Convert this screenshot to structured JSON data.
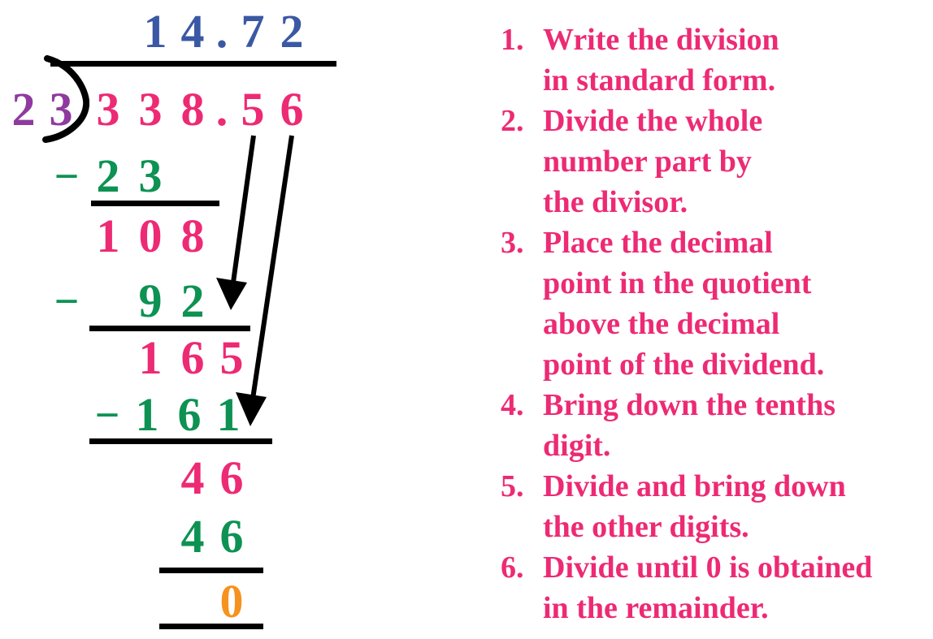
{
  "problem": {
    "type": "long-division-decimal",
    "dividend": "338.56",
    "divisor": "23",
    "quotient": "14.72",
    "remainder": "0"
  },
  "colors": {
    "quotient": "#3a58a4",
    "divisor": "#8f3a9e",
    "dividend": "#ed2a74",
    "subtrahend": "#0d9253",
    "remainder": "#f6921e",
    "rule": "#000000",
    "steps_text": "#ed2a74",
    "background": "#ffffff"
  },
  "work": {
    "quotient_digits": [
      "1",
      "4",
      ".",
      "7",
      "2"
    ],
    "divisor_digits": [
      "2",
      "3"
    ],
    "dividend_digits": [
      "3",
      "3",
      "8",
      ".",
      "5",
      "6"
    ],
    "rows": [
      {
        "name": "subtract-23",
        "sign": "−",
        "digits": [
          "2",
          "3"
        ]
      },
      {
        "name": "partial-108",
        "sign": "",
        "digits": [
          "1",
          "0",
          "8"
        ]
      },
      {
        "name": "subtract-92",
        "sign": "−",
        "digits": [
          "9",
          "2"
        ]
      },
      {
        "name": "partial-165",
        "sign": "",
        "digits": [
          "1",
          "6",
          "5"
        ]
      },
      {
        "name": "subtract-161",
        "sign": "−",
        "digits": [
          "1",
          "6",
          "1"
        ]
      },
      {
        "name": "partial-46",
        "sign": "",
        "digits": [
          "4",
          "6"
        ]
      },
      {
        "name": "subtract-46",
        "sign": "",
        "digits": [
          "4",
          "6"
        ]
      },
      {
        "name": "remainder-0",
        "sign": "",
        "digits": [
          "0"
        ]
      }
    ]
  },
  "steps": {
    "title": "",
    "items": [
      {
        "number": "1.",
        "text": "Write the division\nin standard form."
      },
      {
        "number": "2.",
        "text": "Divide the whole\nnumber part by\nthe divisor."
      },
      {
        "number": "3.",
        "text": "Place the decimal\npoint in the quotient\nabove the decimal\npoint of the dividend."
      },
      {
        "number": "4.",
        "text": "Bring down the tenths\ndigit."
      },
      {
        "number": "5.",
        "text": "Divide and bring down\nthe other digits."
      },
      {
        "number": "6.",
        "text": "Divide until 0 is obtained\n in the remainder."
      }
    ]
  },
  "annotations": {
    "bring_down_arrows": [
      {
        "name": "bring-down-tenths-arrow",
        "label": "arrow from 5 down to 165 row"
      },
      {
        "name": "bring-down-hundredths-arrow",
        "label": "arrow from 6 down to 46 row"
      }
    ],
    "division_bracket": "division-bracket-arc"
  }
}
